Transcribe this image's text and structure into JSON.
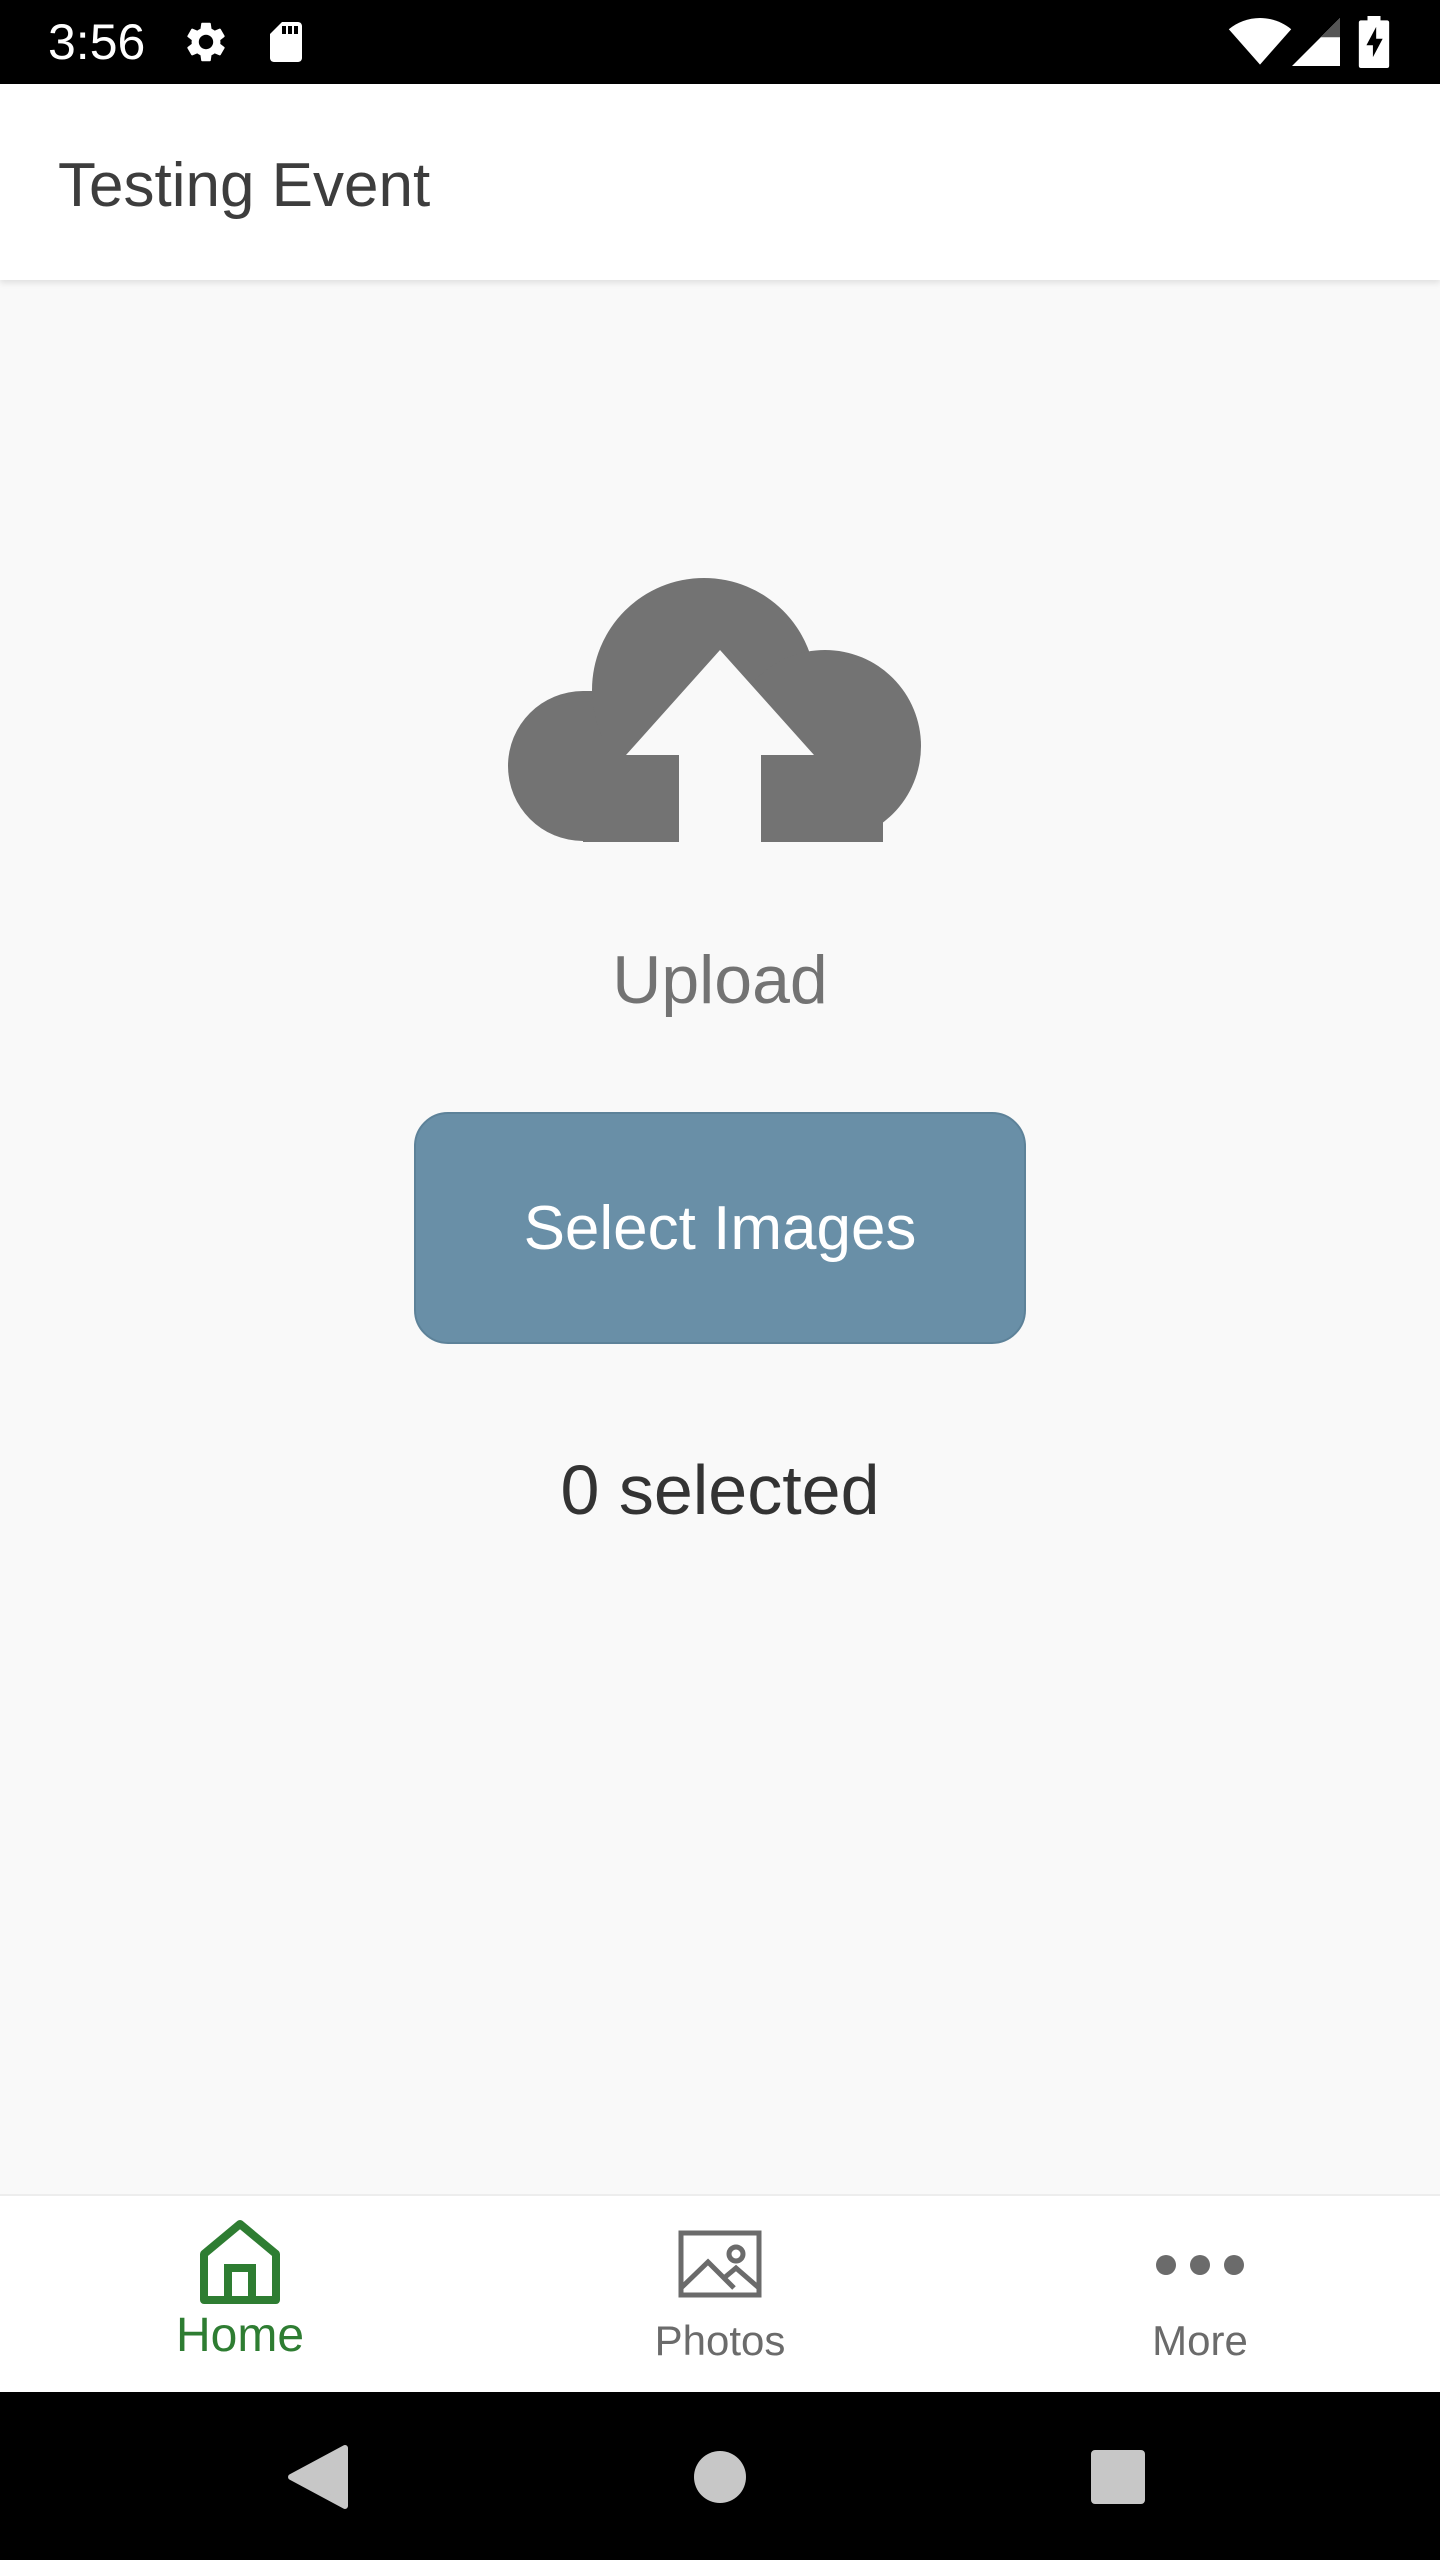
{
  "status_bar": {
    "time": "3:56",
    "left_icons": [
      "gear-icon",
      "sd-card-icon"
    ],
    "right_icons": [
      "wifi-icon",
      "signal-icon",
      "battery-charging-icon"
    ]
  },
  "app_bar": {
    "title": "Testing Event"
  },
  "main": {
    "upload_icon": "cloud-upload-icon",
    "upload_label": "Upload",
    "select_button_label": "Select Images",
    "selected_count": "0 selected"
  },
  "bottom_nav": {
    "items": [
      {
        "label": "Home",
        "icon": "home-icon",
        "active": true
      },
      {
        "label": "Photos",
        "icon": "image-icon",
        "active": false
      },
      {
        "label": "More",
        "icon": "more-horizontal-icon",
        "active": false
      }
    ]
  },
  "system_nav": {
    "buttons": [
      "back-icon",
      "home-circle-icon",
      "recents-icon"
    ]
  },
  "colors": {
    "accent_active": "#2e7d32",
    "inactive": "#6b6b6b",
    "button_bg": "#698fa7",
    "icon_gray": "#737373",
    "background": "#f9f9f9"
  }
}
